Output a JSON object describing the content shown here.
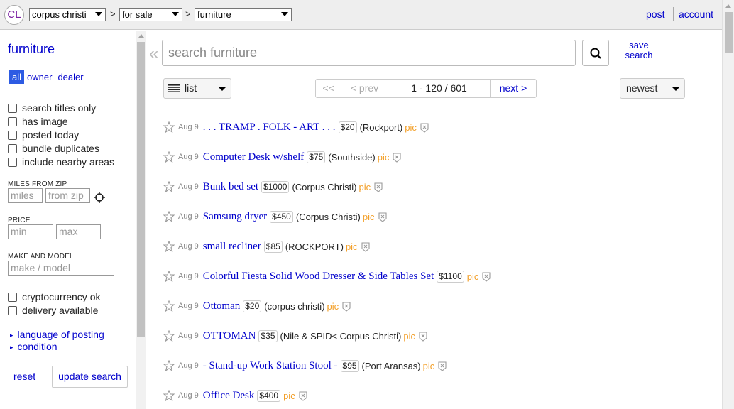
{
  "topbar": {
    "logo": "CL",
    "city": "corpus christi",
    "category": "for sale",
    "subcategory": "furniture",
    "separator": ">",
    "post": "post",
    "account": "account"
  },
  "sidebar": {
    "title": "furniture",
    "seller_type": [
      "all",
      "owner",
      "dealer"
    ],
    "filters": [
      "search titles only",
      "has image",
      "posted today",
      "bundle duplicates",
      "include nearby areas"
    ],
    "miles_label": "MILES FROM ZIP",
    "miles_placeholder": "miles",
    "zip_placeholder": "from zip",
    "price_label": "PRICE",
    "min_placeholder": "min",
    "max_placeholder": "max",
    "make_label": "MAKE AND MODEL",
    "make_placeholder": "make / model",
    "extra_filters": [
      "cryptocurrency ok",
      "delivery available"
    ],
    "expanders": [
      "language of posting",
      "condition"
    ],
    "reset": "reset",
    "update": "update search"
  },
  "search": {
    "collapse_glyph": "«",
    "placeholder": "search furniture",
    "save_label": "save search"
  },
  "controls": {
    "view": "list",
    "first": "<<",
    "prev": "< prev",
    "range": "1 - 120 / 601",
    "next": "next >",
    "sort": "newest"
  },
  "listings": [
    {
      "date": "Aug 9",
      "title": ". . . TRAMP . FOLK - ART . . .",
      "price": "$20",
      "location": "(Rockport)",
      "pic": "pic"
    },
    {
      "date": "Aug 9",
      "title": "Computer Desk w/shelf",
      "price": "$75",
      "location": "(Southside)",
      "pic": "pic"
    },
    {
      "date": "Aug 9",
      "title": "Bunk bed set",
      "price": "$1000",
      "location": "(Corpus Christi)",
      "pic": "pic"
    },
    {
      "date": "Aug 9",
      "title": "Samsung dryer",
      "price": "$450",
      "location": "(Corpus Christi)",
      "pic": "pic"
    },
    {
      "date": "Aug 9",
      "title": "small recliner",
      "price": "$85",
      "location": "(ROCKPORT)",
      "pic": "pic"
    },
    {
      "date": "Aug 9",
      "title": "Colorful Fiesta Solid Wood Dresser & Side Tables Set",
      "price": "$1100",
      "location": "",
      "pic": "pic"
    },
    {
      "date": "Aug 9",
      "title": "Ottoman",
      "price": "$20",
      "location": "(corpus christi)",
      "pic": "pic"
    },
    {
      "date": "Aug 9",
      "title": "OTTOMAN",
      "price": "$35",
      "location": "(Nile & SPID< Corpus Christi)",
      "pic": "pic"
    },
    {
      "date": "Aug 9",
      "title": "- Stand-up Work Station Stool -",
      "price": "$95",
      "location": "(Port Aransas)",
      "pic": "pic"
    },
    {
      "date": "Aug 9",
      "title": "Office Desk",
      "price": "$400",
      "location": "",
      "pic": "pic"
    }
  ]
}
